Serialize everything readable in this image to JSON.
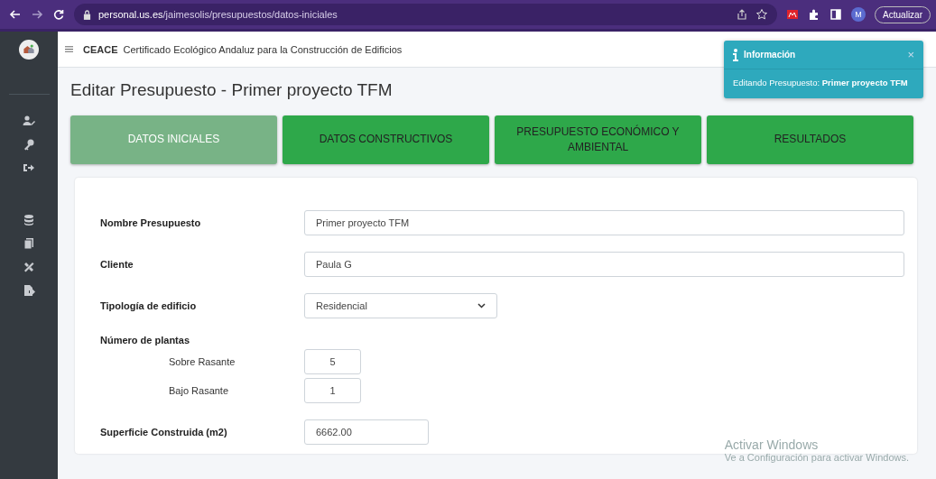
{
  "browser": {
    "url": "**personal.us.es**/jaimesolis/presupuestos/datos-iniciales",
    "profile": "M",
    "update_button": "Actualizar"
  },
  "header": {
    "brand": "CEACE",
    "subtitle": "Certificado Ecológico Andaluz para la Construcción de Edificios"
  },
  "page_title": "Editar Presupuesto - Primer proyecto TFM",
  "tabs": [
    {
      "label": "DATOS INICIALES",
      "selected": true
    },
    {
      "label": "DATOS CONSTRUCTIVOS",
      "selected": false
    },
    {
      "label": "PRESUPUESTO ECONÓMICO Y AMBIENTAL",
      "selected": false
    },
    {
      "label": "RESULTADOS",
      "selected": false
    }
  ],
  "form": [
    {
      "kind": "text",
      "label": "Nombre Presupuesto",
      "value": "Primer proyecto TFM"
    },
    {
      "kind": "text",
      "label": "Cliente",
      "value": "Paula G"
    },
    {
      "kind": "select",
      "label": "Tipología de edificio",
      "value": "Residencial"
    },
    {
      "kind": "group",
      "label": "Número de plantas",
      "children": [
        {
          "label": "Sobre Rasante",
          "value": "5"
        },
        {
          "label": "Bajo Rasante",
          "value": "1"
        }
      ]
    },
    {
      "kind": "short",
      "label": "Superficie Construida (m2)",
      "value": "6662.00"
    }
  ],
  "toast": {
    "title": "Información",
    "close": "×",
    "message": "Editando Presupuesto: **Primer proyecto TFM**"
  },
  "os_notice": {
    "title": "Activar Windows",
    "text": "Ve a Configuración para activar Windows."
  }
}
